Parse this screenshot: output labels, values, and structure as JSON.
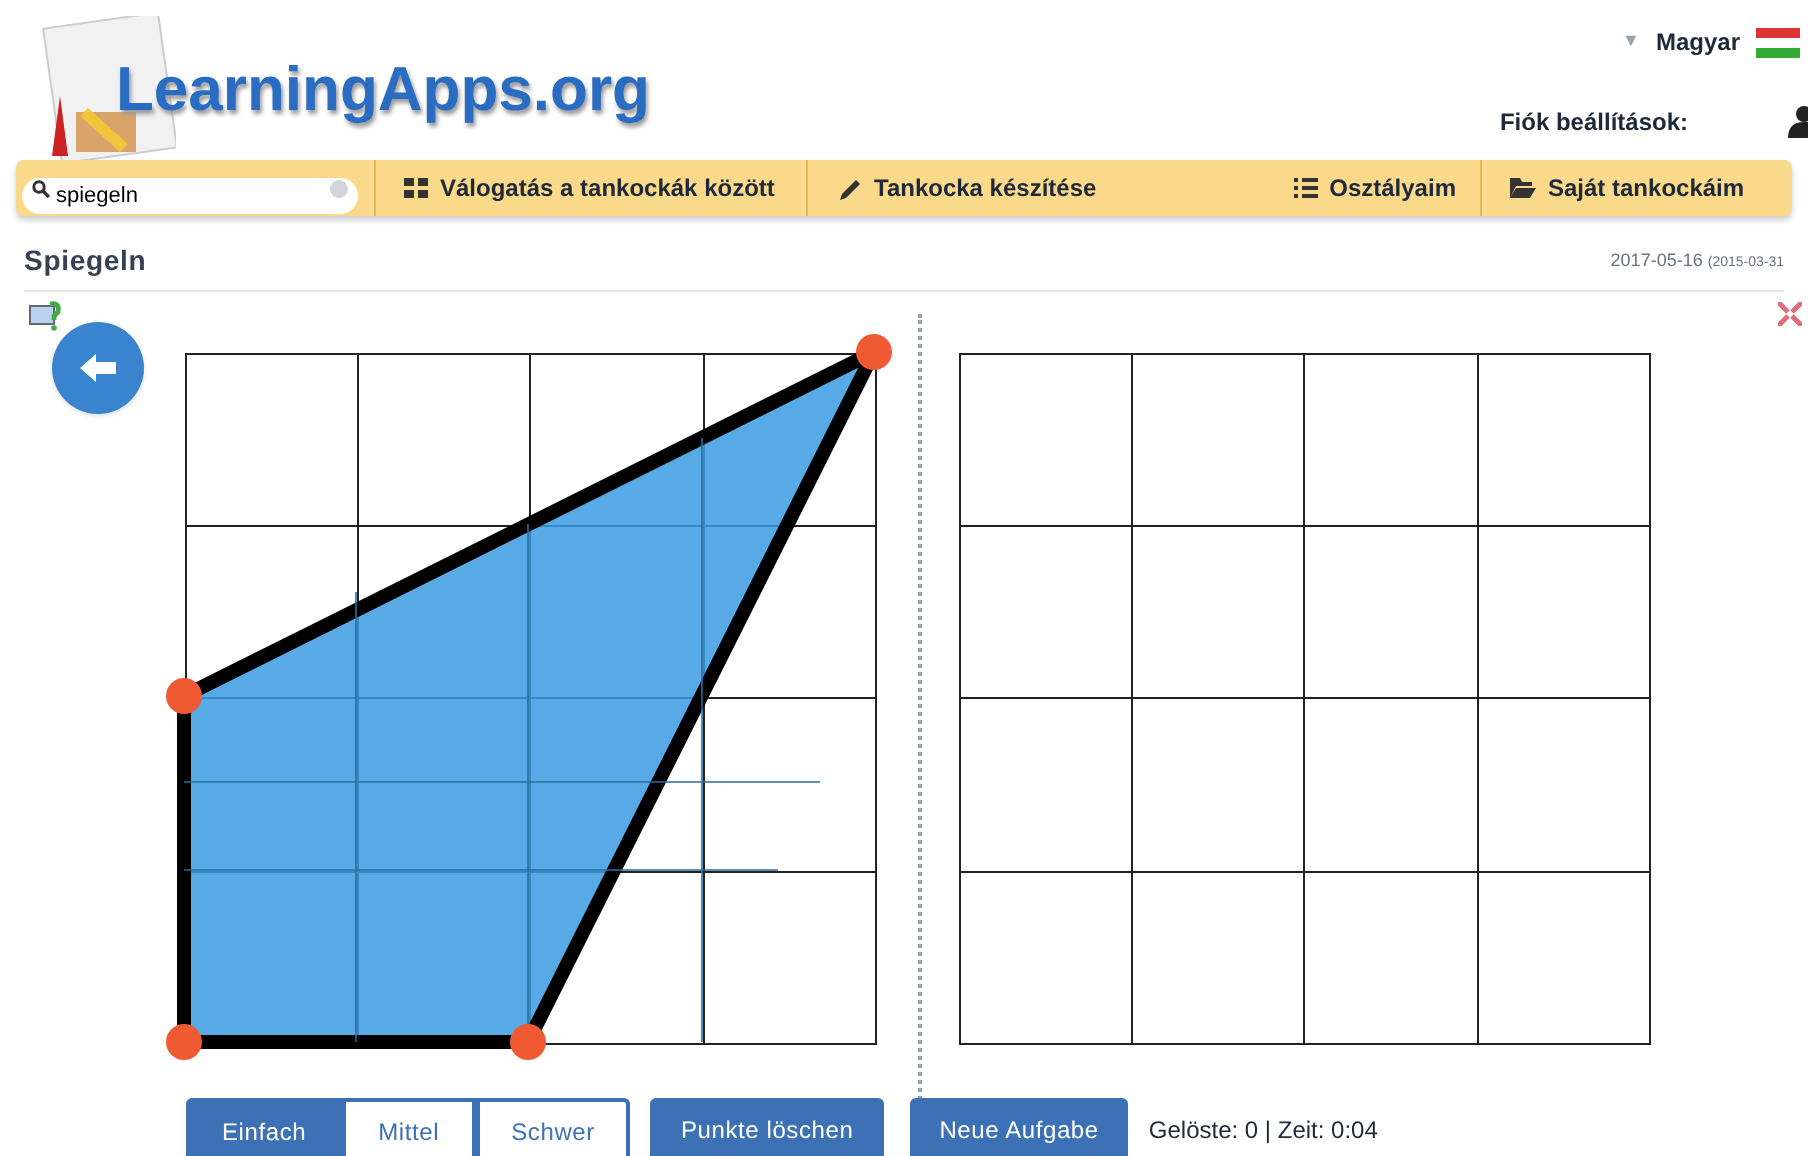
{
  "header": {
    "logo": "LearningApps.org",
    "language_caret": "▼",
    "language": "Magyar",
    "account_label": "Fiók beállítások:"
  },
  "nav": {
    "search": {
      "value": "spiegeln"
    },
    "items": [
      {
        "kind": "grid",
        "label": "Válogatás a tankockák között"
      },
      {
        "kind": "pencil",
        "label": "Tankocka készítése"
      },
      {
        "kind": "list",
        "label": "Osztályaim"
      },
      {
        "kind": "folder",
        "label": "Saját tankockáim"
      }
    ]
  },
  "app": {
    "title": "Spiegeln",
    "date": "2017-05-16",
    "created": "(2015-03-31"
  },
  "levels": [
    {
      "label": "Einfach",
      "selected": true
    },
    {
      "label": "Mittel",
      "selected": false
    },
    {
      "label": "Schwer",
      "selected": false
    }
  ],
  "buttons": [
    "Punkte löschen",
    "Neue Aufgabe"
  ],
  "status": "Gelöste: 0 | Zeit: 0:04"
}
